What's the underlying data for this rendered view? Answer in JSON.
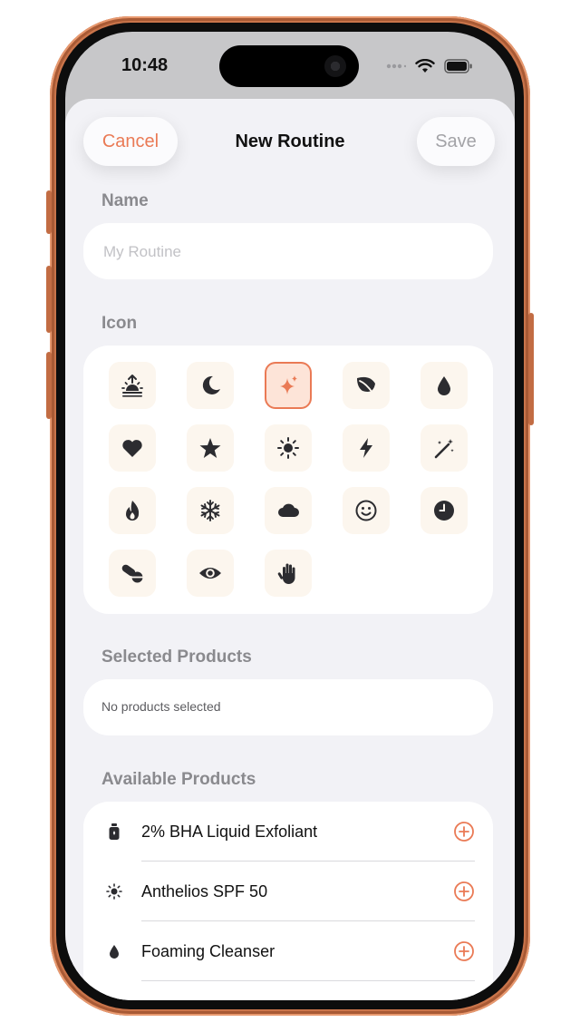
{
  "status_bar": {
    "time": "10:48"
  },
  "nav": {
    "cancel_label": "Cancel",
    "title": "New Routine",
    "save_label": "Save"
  },
  "name_section": {
    "label": "Name",
    "placeholder": "My Routine",
    "value": ""
  },
  "icon_section": {
    "label": "Icon",
    "selected": "sparkles-icon",
    "icons": [
      "sunrise-icon",
      "moon-icon",
      "sparkles-icon",
      "leaf-icon",
      "drop-icon",
      "heart-icon",
      "star-icon",
      "sun-icon",
      "bolt-icon",
      "magic-wand-icon",
      "flame-icon",
      "snowflake-icon",
      "cloud-icon",
      "smiley-icon",
      "clock-icon",
      "pills-icon",
      "eye-icon",
      "hand-icon"
    ]
  },
  "selected_products": {
    "label": "Selected Products",
    "empty_text": "No products selected"
  },
  "available_products": {
    "label": "Available Products",
    "items": [
      {
        "name": "2% BHA Liquid Exfoliant",
        "icon": "bottle-icon"
      },
      {
        "name": "Anthelios SPF 50",
        "icon": "sun-icon"
      },
      {
        "name": "Foaming Cleanser",
        "icon": "drop-icon"
      }
    ]
  },
  "colors": {
    "accent": "#ea7a55",
    "background": "#f2f2f6",
    "tile": "#fcf6ee",
    "frame": "#c9744a"
  }
}
